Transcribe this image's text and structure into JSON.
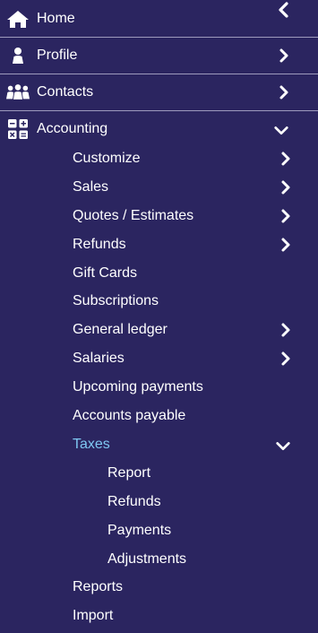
{
  "sidebar": {
    "collapse_icon": "chevron-left-icon",
    "items": [
      {
        "label": "Home",
        "icon": "home-icon"
      },
      {
        "label": "Profile",
        "icon": "user-icon"
      },
      {
        "label": "Contacts",
        "icon": "users-icon"
      },
      {
        "label": "Accounting",
        "icon": "calculator-icon",
        "expanded": true
      }
    ],
    "accounting": {
      "children": [
        {
          "label": "Customize",
          "has_children": true
        },
        {
          "label": "Sales",
          "has_children": true
        },
        {
          "label": "Quotes / Estimates",
          "has_children": true
        },
        {
          "label": "Refunds",
          "has_children": true
        },
        {
          "label": "Gift Cards",
          "has_children": false
        },
        {
          "label": "Subscriptions",
          "has_children": false
        },
        {
          "label": "General ledger",
          "has_children": true
        },
        {
          "label": "Salaries",
          "has_children": true
        },
        {
          "label": "Upcoming payments",
          "has_children": false
        },
        {
          "label": "Accounts payable",
          "has_children": false
        },
        {
          "label": "Taxes",
          "has_children": true,
          "expanded": true,
          "active": true
        },
        {
          "label": "Reports",
          "has_children": false
        },
        {
          "label": "Import",
          "has_children": false
        }
      ],
      "taxes": {
        "children": [
          {
            "label": "Report"
          },
          {
            "label": "Refunds"
          },
          {
            "label": "Payments"
          },
          {
            "label": "Adjustments"
          }
        ]
      }
    }
  },
  "colors": {
    "background": "#2b2560",
    "text": "#ffffff",
    "active_text": "#7fc7f2",
    "divider": "#9e9bbd"
  }
}
